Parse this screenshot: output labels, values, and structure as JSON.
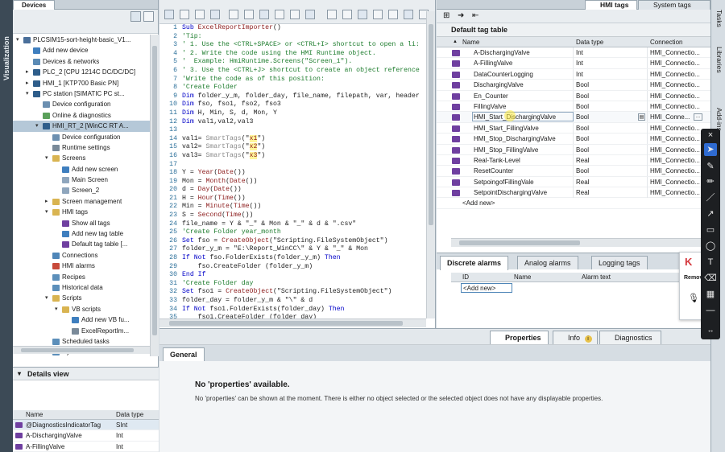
{
  "sidebar_label": "Visualization",
  "project_tree": {
    "header": "Devices",
    "items": [
      {
        "label": "PLCSIM15-sort-height-basic_V1...",
        "indent": 0,
        "arrow": "▾",
        "icon": "#4a6f9a"
      },
      {
        "label": "Add new device",
        "indent": 1,
        "arrow": "",
        "icon": "#3f7fbf"
      },
      {
        "label": "Devices & networks",
        "indent": 1,
        "arrow": "",
        "icon": "#5b8bb5"
      },
      {
        "label": "PLC_2 [CPU 1214C DC/DC/DC]",
        "indent": 1,
        "arrow": "▸",
        "icon": "#2e5d8a"
      },
      {
        "label": "HMI_1 [KTP700 Basic PN]",
        "indent": 1,
        "arrow": "▸",
        "icon": "#2e5d8a"
      },
      {
        "label": "PC station [SIMATIC PC st...",
        "indent": 1,
        "arrow": "▾",
        "icon": "#2e5d8a"
      },
      {
        "label": "Device configuration",
        "indent": 2,
        "arrow": "",
        "icon": "#6b8fb0"
      },
      {
        "label": "Online & diagnostics",
        "indent": 2,
        "arrow": "",
        "icon": "#5aa05a"
      },
      {
        "label": "HMI_RT_2 [WinCC RT A...",
        "indent": 2,
        "arrow": "▾",
        "icon": "#2e5d8a",
        "selected": true
      },
      {
        "label": "Device configuration",
        "indent": 3,
        "arrow": "",
        "icon": "#6b8fb0"
      },
      {
        "label": "Runtime settings",
        "indent": 3,
        "arrow": "",
        "icon": "#7a8a99"
      },
      {
        "label": "Screens",
        "indent": 3,
        "arrow": "▾",
        "icon": "#d9b451"
      },
      {
        "label": "Add new screen",
        "indent": 4,
        "arrow": "",
        "icon": "#3f7fbf"
      },
      {
        "label": "Main Screen",
        "indent": 4,
        "arrow": "",
        "icon": "#8fa6bd"
      },
      {
        "label": "Screen_2",
        "indent": 4,
        "arrow": "",
        "icon": "#8fa6bd"
      },
      {
        "label": "Screen management",
        "indent": 3,
        "arrow": "▸",
        "icon": "#d9b451"
      },
      {
        "label": "HMI tags",
        "indent": 3,
        "arrow": "▾",
        "icon": "#d9b451"
      },
      {
        "label": "Show all tags",
        "indent": 4,
        "arrow": "",
        "icon": "#6f3fa0"
      },
      {
        "label": "Add new tag table",
        "indent": 4,
        "arrow": "",
        "icon": "#3f7fbf"
      },
      {
        "label": "Default tag table [...",
        "indent": 4,
        "arrow": "",
        "icon": "#6f3fa0"
      },
      {
        "label": "Connections",
        "indent": 3,
        "arrow": "",
        "icon": "#4f86b8"
      },
      {
        "label": "HMI alarms",
        "indent": 3,
        "arrow": "",
        "icon": "#c84a3a"
      },
      {
        "label": "Recipes",
        "indent": 3,
        "arrow": "",
        "icon": "#5c8fba"
      },
      {
        "label": "Historical data",
        "indent": 3,
        "arrow": "",
        "icon": "#5c8fba"
      },
      {
        "label": "Scripts",
        "indent": 3,
        "arrow": "▾",
        "icon": "#d9b451"
      },
      {
        "label": "VB scripts",
        "indent": 4,
        "arrow": "▾",
        "icon": "#d9b451"
      },
      {
        "label": "Add new VB fu...",
        "indent": 5,
        "arrow": "",
        "icon": "#3f7fbf"
      },
      {
        "label": "ExcelReportIm...",
        "indent": 5,
        "arrow": "",
        "icon": "#7a8a99"
      },
      {
        "label": "Scheduled tasks",
        "indent": 3,
        "arrow": "",
        "icon": "#5c8fba"
      },
      {
        "label": "Cycles",
        "indent": 3,
        "arrow": "",
        "icon": "#5c8fba"
      }
    ]
  },
  "details_view": {
    "title": "Details view",
    "columns": [
      "Name",
      "Data type"
    ],
    "rows": [
      {
        "name": "@DiagnosticsIndicatorTag",
        "type": "SInt"
      },
      {
        "name": "A-DischargingValve",
        "type": "Int"
      },
      {
        "name": "A-FillingValve",
        "type": "Int"
      }
    ]
  },
  "code_editor": {
    "lines": [
      [
        {
          "t": "Sub ",
          "c": "#0000c8"
        },
        {
          "t": "ExcelReportImporter",
          "c": "#8b1a1a"
        },
        {
          "t": "()",
          "c": "#222"
        }
      ],
      [
        {
          "t": "'Tip:",
          "c": "#1e7d2e"
        }
      ],
      [
        {
          "t": "' 1. Use the <CTRL+SPACE> or <CTRL+I> shortcut to open a li:",
          "c": "#1e7d2e"
        }
      ],
      [
        {
          "t": "' 2. Write the code using the HMI Runtime object.",
          "c": "#1e7d2e"
        }
      ],
      [
        {
          "t": "'  Example: HmiRuntime.Screens(\"Screen_1\").",
          "c": "#1e7d2e"
        }
      ],
      [
        {
          "t": "' 3. Use the <CTRL+J> shortcut to create an object reference",
          "c": "#1e7d2e"
        }
      ],
      [
        {
          "t": "'Write the code as of this position:",
          "c": "#1e7d2e"
        }
      ],
      [
        {
          "t": "'Create Folder",
          "c": "#1e7d2e"
        }
      ],
      [
        {
          "t": "Dim ",
          "c": "#0000c8"
        },
        {
          "t": "folder_y_m, folder_day, file_name, filepath, var, header",
          "c": "#222"
        }
      ],
      [
        {
          "t": "Dim ",
          "c": "#0000c8"
        },
        {
          "t": "fso, fso1, fso2, fso3",
          "c": "#222"
        }
      ],
      [
        {
          "t": "Dim ",
          "c": "#0000c8"
        },
        {
          "t": "H, Min, S, d, Mon, Y",
          "c": "#222"
        }
      ],
      [
        {
          "t": "Dim ",
          "c": "#0000c8"
        },
        {
          "t": "val1,val2,val3",
          "c": "#222"
        }
      ],
      [
        {
          "t": "",
          "c": "#222"
        }
      ],
      [
        {
          "t": "val1= ",
          "c": "#222"
        },
        {
          "t": "SmartTags",
          "c": "#8a8a8a"
        },
        {
          "t": "(\"",
          "c": "#222"
        },
        {
          "t": "x1",
          "c": "#8b1a1a",
          "hl": true
        },
        {
          "t": "\")",
          "c": "#222"
        }
      ],
      [
        {
          "t": "val2= ",
          "c": "#222"
        },
        {
          "t": "SmartTags",
          "c": "#8a8a8a"
        },
        {
          "t": "(\"",
          "c": "#222"
        },
        {
          "t": "x2",
          "c": "#8b1a1a",
          "hl": true
        },
        {
          "t": "\")",
          "c": "#222"
        }
      ],
      [
        {
          "t": "val3= ",
          "c": "#222"
        },
        {
          "t": "SmartTags",
          "c": "#8a8a8a"
        },
        {
          "t": "(\"",
          "c": "#222"
        },
        {
          "t": "x3",
          "c": "#8b1a1a",
          "hl": true
        },
        {
          "t": "\")",
          "c": "#222"
        }
      ],
      [
        {
          "t": "",
          "c": "#222"
        }
      ],
      [
        {
          "t": "Y = ",
          "c": "#222"
        },
        {
          "t": "Year",
          "c": "#8b1a1a"
        },
        {
          "t": "(",
          "c": "#222"
        },
        {
          "t": "Date",
          "c": "#8b1a1a"
        },
        {
          "t": "())",
          "c": "#222"
        }
      ],
      [
        {
          "t": "Mon = ",
          "c": "#222"
        },
        {
          "t": "Month",
          "c": "#8b1a1a"
        },
        {
          "t": "(",
          "c": "#222"
        },
        {
          "t": "Date",
          "c": "#8b1a1a"
        },
        {
          "t": "())",
          "c": "#222"
        }
      ],
      [
        {
          "t": "d = ",
          "c": "#222"
        },
        {
          "t": "Day",
          "c": "#8b1a1a"
        },
        {
          "t": "(",
          "c": "#222"
        },
        {
          "t": "Date",
          "c": "#8b1a1a"
        },
        {
          "t": "())",
          "c": "#222"
        }
      ],
      [
        {
          "t": "H = ",
          "c": "#222"
        },
        {
          "t": "Hour",
          "c": "#8b1a1a"
        },
        {
          "t": "(",
          "c": "#222"
        },
        {
          "t": "Time",
          "c": "#8b1a1a"
        },
        {
          "t": "())",
          "c": "#222"
        }
      ],
      [
        {
          "t": "Min = ",
          "c": "#222"
        },
        {
          "t": "Minute",
          "c": "#8b1a1a"
        },
        {
          "t": "(",
          "c": "#222"
        },
        {
          "t": "Time",
          "c": "#8b1a1a"
        },
        {
          "t": "())",
          "c": "#222"
        }
      ],
      [
        {
          "t": "S = ",
          "c": "#222"
        },
        {
          "t": "Second",
          "c": "#8b1a1a"
        },
        {
          "t": "(",
          "c": "#222"
        },
        {
          "t": "Time",
          "c": "#8b1a1a"
        },
        {
          "t": "())",
          "c": "#222"
        }
      ],
      [
        {
          "t": "file_name = Y & \"_\" & Mon & \"_\" & d & \".csv\"",
          "c": "#222"
        }
      ],
      [
        {
          "t": "'Create Folder year_month",
          "c": "#1e7d2e"
        }
      ],
      [
        {
          "t": "Set ",
          "c": "#0000c8"
        },
        {
          "t": "fso = ",
          "c": "#222"
        },
        {
          "t": "CreateObject",
          "c": "#8b1a1a"
        },
        {
          "t": "(\"Scripting.FileSystemObject\")",
          "c": "#222"
        }
      ],
      [
        {
          "t": "folder_y_m = \"E:\\Report_WinCC\\\" & Y & \"_\" & Mon",
          "c": "#222"
        }
      ],
      [
        {
          "t": "If Not ",
          "c": "#0000c8"
        },
        {
          "t": "fso.FolderExists(folder_y_m) ",
          "c": "#222"
        },
        {
          "t": "Then",
          "c": "#0000c8"
        }
      ],
      [
        {
          "t": "    fso.CreateFolder (folder_y_m)",
          "c": "#222"
        }
      ],
      [
        {
          "t": "End If",
          "c": "#0000c8"
        }
      ],
      [
        {
          "t": "'Create Folder day",
          "c": "#1e7d2e"
        }
      ],
      [
        {
          "t": "Set ",
          "c": "#0000c8"
        },
        {
          "t": "fso1 = ",
          "c": "#222"
        },
        {
          "t": "CreateObject",
          "c": "#8b1a1a"
        },
        {
          "t": "(\"Scripting.FileSystemObject\")",
          "c": "#222"
        }
      ],
      [
        {
          "t": "folder_day = folder_y_m & \"\\\" & d",
          "c": "#222"
        }
      ],
      [
        {
          "t": "If Not ",
          "c": "#0000c8"
        },
        {
          "t": "fso1.FolderExists(folder_day) ",
          "c": "#222"
        },
        {
          "t": "Then",
          "c": "#0000c8"
        }
      ],
      [
        {
          "t": "    fso1.CreateFolder (folder_day)",
          "c": "#222"
        }
      ]
    ]
  },
  "hmi_tags": {
    "tabs": [
      "HMI tags",
      "System tags"
    ],
    "title": "Default tag table",
    "columns": [
      "Name",
      "Data type",
      "Connection"
    ],
    "rows": [
      {
        "name": "A-DischargingValve",
        "type": "Int",
        "conn": "HMI_Connectio..."
      },
      {
        "name": "A-FillingValve",
        "type": "Int",
        "conn": "HMI_Connectio..."
      },
      {
        "name": "DataCounterLogging",
        "type": "Int",
        "conn": "HMI_Connectio..."
      },
      {
        "name": "DischargingValve",
        "type": "Bool",
        "conn": "HMI_Connectio..."
      },
      {
        "name": "En_Counter",
        "type": "Bool",
        "conn": "HMI_Connectio..."
      },
      {
        "name": "FillingValve",
        "type": "Bool",
        "conn": "HMI_Connectio..."
      },
      {
        "name": "HMI_Start_DischargingValve",
        "type": "Bool",
        "conn": "HMI_Conne...",
        "editing": true
      },
      {
        "name": "HMI_Start_FillingValve",
        "type": "Bool",
        "conn": "HMI_Connectio..."
      },
      {
        "name": "HMI_Stop_DischargingValve",
        "type": "Bool",
        "conn": "HMI_Connectio..."
      },
      {
        "name": "HMI_Stop_FillingValve",
        "type": "Bool",
        "conn": "HMI_Connectio..."
      },
      {
        "name": "Real-Tank-Level",
        "type": "Real",
        "conn": "HMI_Connectio..."
      },
      {
        "name": "ResetCounter",
        "type": "Bool",
        "conn": "HMI_Connectio..."
      },
      {
        "name": "SetpoingofFillingVale",
        "type": "Real",
        "conn": "HMI_Connectio..."
      },
      {
        "name": "SetpointDischargingValve",
        "type": "Real",
        "conn": "HMI_Connectio..."
      }
    ],
    "add_new": "<Add new>"
  },
  "alarms": {
    "tabs": [
      "Discrete alarms",
      "Analog alarms",
      "Logging tags"
    ],
    "columns": [
      "ID",
      "Name",
      "Alarm text"
    ],
    "add_new": "<Add new>"
  },
  "properties": {
    "tabs": [
      "Properties",
      "Info",
      "Diagnostics"
    ],
    "info_badge": "i",
    "general_tab": "General",
    "heading": "No 'properties' available.",
    "message": "No 'properties' can be shown at the moment. There is either no object selected or the selected object does not have any displayable properties."
  },
  "right_tabs": [
    "Tasks",
    "Libraries",
    "Add-ins"
  ],
  "popup": {
    "remove_label": "Remov"
  },
  "colors": {
    "accent": "#2e5d8a",
    "tag_icon": "#6f3fa0",
    "highlight": "#fff59a"
  }
}
